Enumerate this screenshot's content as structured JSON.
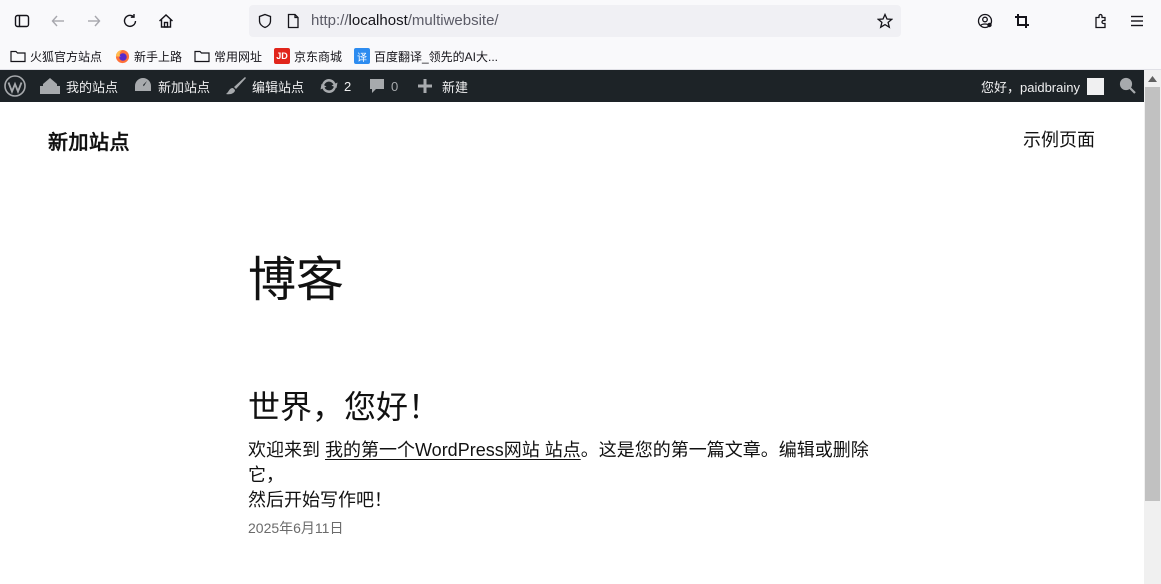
{
  "browser": {
    "url_prefix": "http://",
    "url_host": "localhost",
    "url_path": "/multiwebsite/"
  },
  "bookmarks": [
    {
      "label": "火狐官方站点",
      "icon": "folder-icon"
    },
    {
      "label": "新手上路",
      "icon": "firefox-icon"
    },
    {
      "label": "常用网址",
      "icon": "folder-icon"
    },
    {
      "label": "京东商城",
      "icon": "jd-icon",
      "icon_text": "JD"
    },
    {
      "label": "百度翻译_领先的AI大...",
      "icon": "baidu-translate-icon",
      "icon_text": "译"
    }
  ],
  "adminbar": {
    "my_sites": "我的站点",
    "site_name": "新加站点",
    "edit_site": "编辑站点",
    "updates_count": "2",
    "comments_count": "0",
    "new": "新建",
    "greeting": "您好，paidbrainy"
  },
  "site": {
    "title": "新加站点",
    "nav_item": "示例页面",
    "heading": "博客",
    "post": {
      "title": "世界，您好！",
      "excerpt_before": "欢迎来到 ",
      "excerpt_link": "我的第一个WordPress网站 站点",
      "excerpt_after_line1": "。这是您的第一篇文章。编辑或删除它，",
      "excerpt_line2": "然后开始写作吧！",
      "date": "2025年6月11日"
    }
  },
  "colors": {
    "adminbar_bg": "#1d2327",
    "adminbar_text": "#f0f0f1",
    "jd_red": "#e1251b",
    "baidu_blue": "#2d8cf0"
  }
}
